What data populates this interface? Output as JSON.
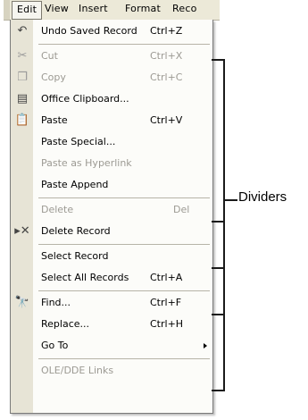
{
  "menubar": {
    "items": [
      "Edit",
      "View",
      "Insert",
      "Format",
      "Reco"
    ]
  },
  "menu": {
    "items": [
      {
        "icon": "undo-icon",
        "label": "Undo Saved Record",
        "shortcut": "Ctrl+Z",
        "disabled": false
      },
      {
        "icon": "cut-icon",
        "label": "Cut",
        "shortcut": "Ctrl+X",
        "disabled": true
      },
      {
        "icon": "copy-icon",
        "label": "Copy",
        "shortcut": "Ctrl+C",
        "disabled": true
      },
      {
        "icon": "office-clipboard-icon",
        "label": "Office Clipboard...",
        "shortcut": "",
        "disabled": false
      },
      {
        "icon": "paste-icon",
        "label": "Paste",
        "shortcut": "Ctrl+V",
        "disabled": false
      },
      {
        "icon": "",
        "label": "Paste Special...",
        "shortcut": "",
        "disabled": false
      },
      {
        "icon": "",
        "label": "Paste as Hyperlink",
        "shortcut": "",
        "disabled": true
      },
      {
        "icon": "",
        "label": "Paste Append",
        "shortcut": "",
        "disabled": false
      },
      {
        "icon": "",
        "label": "Delete",
        "shortcut": "Del",
        "disabled": true
      },
      {
        "icon": "delete-record-icon",
        "label": "Delete Record",
        "shortcut": "",
        "disabled": false
      },
      {
        "icon": "",
        "label": "Select Record",
        "shortcut": "",
        "disabled": false
      },
      {
        "icon": "",
        "label": "Select All Records",
        "shortcut": "Ctrl+A",
        "disabled": false
      },
      {
        "icon": "find-icon",
        "label": "Find...",
        "shortcut": "Ctrl+F",
        "disabled": false
      },
      {
        "icon": "",
        "label": "Replace...",
        "shortcut": "Ctrl+H",
        "disabled": false
      },
      {
        "icon": "",
        "label": "Go To",
        "shortcut": "",
        "disabled": false,
        "submenu": true
      },
      {
        "icon": "",
        "label": "OLE/DDE Links",
        "shortcut": "",
        "disabled": true
      }
    ]
  },
  "callout": {
    "label": "Dividers"
  }
}
